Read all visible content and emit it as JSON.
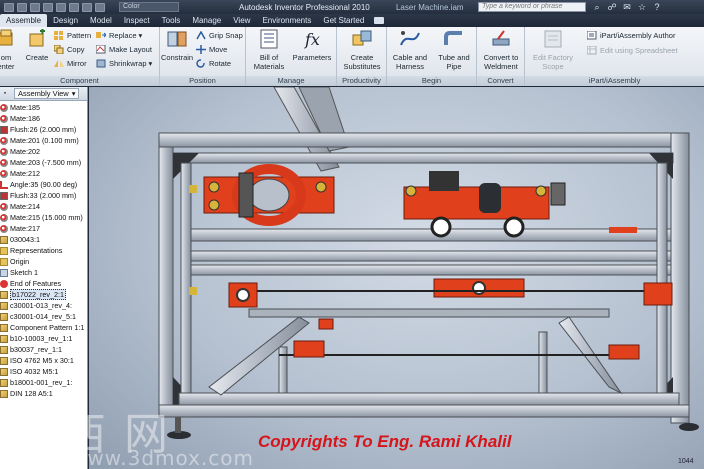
{
  "window": {
    "title": "Autodesk Inventor Professional 2010",
    "document": "Laser Machine.iam",
    "color_combo": "Color",
    "search_placeholder": "Type a keyword or phrase"
  },
  "menu": [
    "Assemble",
    "Design",
    "Model",
    "Inspect",
    "Tools",
    "Manage",
    "View",
    "Environments",
    "Get Started"
  ],
  "active_menu": "Assemble",
  "ribbon": {
    "component": {
      "title": "Component",
      "place_line1": "om",
      "place_line2": "enter",
      "create": "Create",
      "pattern": "Pattern",
      "copy": "Copy",
      "mirror": "Mirror",
      "replace": "Replace",
      "make_layout": "Make Layout",
      "shrinkwrap": "Shrinkwrap"
    },
    "position": {
      "title": "Position",
      "constrain": "Constrain",
      "grip_snap": "Grip Snap",
      "move": "Move",
      "rotate": "Rotate"
    },
    "manage": {
      "title": "Manage",
      "bom_line1": "Bill of",
      "bom_line2": "Materials",
      "parameters": "Parameters"
    },
    "productivity": {
      "title": "Productivity",
      "cs_line1": "Create",
      "cs_line2": "Substitutes"
    },
    "begin": {
      "title": "Begin",
      "cable_line1": "Cable and",
      "cable_line2": "Harness",
      "tube_line1": "Tube and",
      "tube_line2": "Pipe"
    },
    "convert": {
      "title": "Convert",
      "cw_line1": "Convert to",
      "cw_line2": "Weldment"
    },
    "ipart": {
      "title": "iPart/iAssembly",
      "efs_line1": "Edit Factory",
      "efs_line2": "Scope",
      "author": "iPart/iAssembly Author",
      "spreadsheet": "Edit using Spreadsheet"
    }
  },
  "browser": {
    "view_mode": "Assembly View",
    "nodes": [
      {
        "label": "Mate:185",
        "icon": "mate"
      },
      {
        "label": "Mate:186",
        "icon": "mate"
      },
      {
        "label": "Flush:26 (2.000 mm)",
        "icon": "flush"
      },
      {
        "label": "Mate:201 (0.100 mm)",
        "icon": "mate"
      },
      {
        "label": "Mate:202",
        "icon": "mate"
      },
      {
        "label": "Mate:203 (-7.500 mm)",
        "icon": "mate"
      },
      {
        "label": "Mate:212",
        "icon": "mate"
      },
      {
        "label": "Angle:35 (90.00 deg)",
        "icon": "angle"
      },
      {
        "label": "Flush:33 (2.000 mm)",
        "icon": "flush"
      },
      {
        "label": "Mate:214",
        "icon": "mate"
      },
      {
        "label": "Mate:215 (15.000 mm)",
        "icon": "mate"
      },
      {
        "label": "Mate:217",
        "icon": "mate"
      },
      {
        "label": "030043:1",
        "icon": "part"
      },
      {
        "label": "Representations",
        "icon": "folder"
      },
      {
        "label": "Origin",
        "icon": "folder"
      },
      {
        "label": "Sketch 1",
        "icon": "feat"
      },
      {
        "label": "End of Features",
        "icon": "end"
      },
      {
        "label": "b17022_rev_2:1",
        "icon": "part",
        "selected": true
      },
      {
        "label": "c30001-013_rev_4:",
        "icon": "part"
      },
      {
        "label": "c30001-014_rev_5:1",
        "icon": "part"
      },
      {
        "label": "Component Pattern 1:1",
        "icon": "part"
      },
      {
        "label": "b10-10003_rev_1:1",
        "icon": "part"
      },
      {
        "label": "b30037_rev_1:1",
        "icon": "part"
      },
      {
        "label": "ISO 4762 M5 x 30:1",
        "icon": "part"
      },
      {
        "label": "ISO 4032 M5:1",
        "icon": "part"
      },
      {
        "label": "b18001-001_rev_1:",
        "icon": "part"
      },
      {
        "label": "DIN 128 A5:1",
        "icon": "part"
      }
    ]
  },
  "viewport": {
    "copyright": "Copyrights To Eng. Rami Khalil",
    "watermark_cn": "昊 西 网",
    "watermark_url": "www.3dmox.com",
    "corner_number": "1044"
  },
  "colors": {
    "accent_red": "#d5141b",
    "frame_orange": "#e0401c",
    "aluminum": "#c9ced6",
    "dark_plate": "#3a3f46"
  }
}
